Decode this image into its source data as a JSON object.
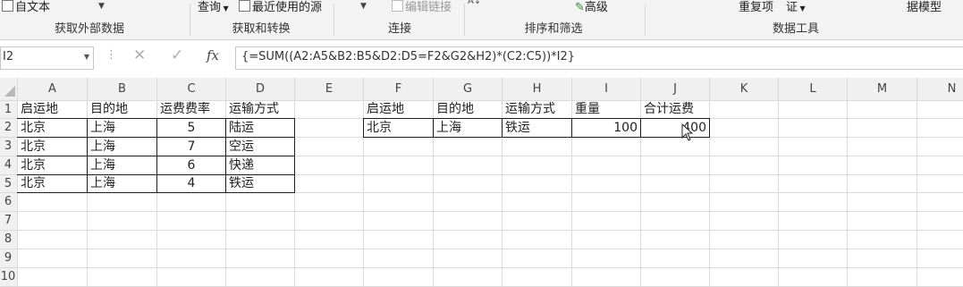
{
  "ribbon": {
    "row_items": [
      "自文本",
      "查询",
      "最近使用的源",
      "编辑链接",
      "高级",
      "重复项",
      "证",
      "据模型"
    ],
    "groups": [
      "获取外部数据",
      "获取和转换",
      "连接",
      "排序和筛选",
      "数据工具"
    ]
  },
  "formula_bar": {
    "name_box": "I2",
    "cancel_icon": "✕",
    "enter_icon": "✓",
    "fx_label": "fx",
    "formula": "{=SUM((A2:A5&B2:B5&D2:D5=F2&G2&H2)*(C2:C5))*I2}"
  },
  "sheet": {
    "columns": [
      "A",
      "B",
      "C",
      "D",
      "E",
      "F",
      "G",
      "H",
      "I",
      "J",
      "K",
      "L",
      "M",
      "N"
    ],
    "rows": [
      "1",
      "2",
      "3",
      "4",
      "5",
      "6",
      "7",
      "8",
      "9",
      "10"
    ],
    "table_left": {
      "headers": [
        "启运地",
        "目的地",
        "运费费率",
        "运输方式"
      ],
      "data": [
        [
          "北京",
          "上海",
          "5",
          "陆运"
        ],
        [
          "北京",
          "上海",
          "7",
          "空运"
        ],
        [
          "北京",
          "上海",
          "6",
          "快递"
        ],
        [
          "北京",
          "上海",
          "4",
          "铁运"
        ]
      ]
    },
    "table_right": {
      "headers": [
        "启运地",
        "目的地",
        "运输方式",
        "重量",
        "合计运费"
      ],
      "values": [
        "北京",
        "上海",
        "铁运",
        "100",
        "400"
      ]
    }
  }
}
